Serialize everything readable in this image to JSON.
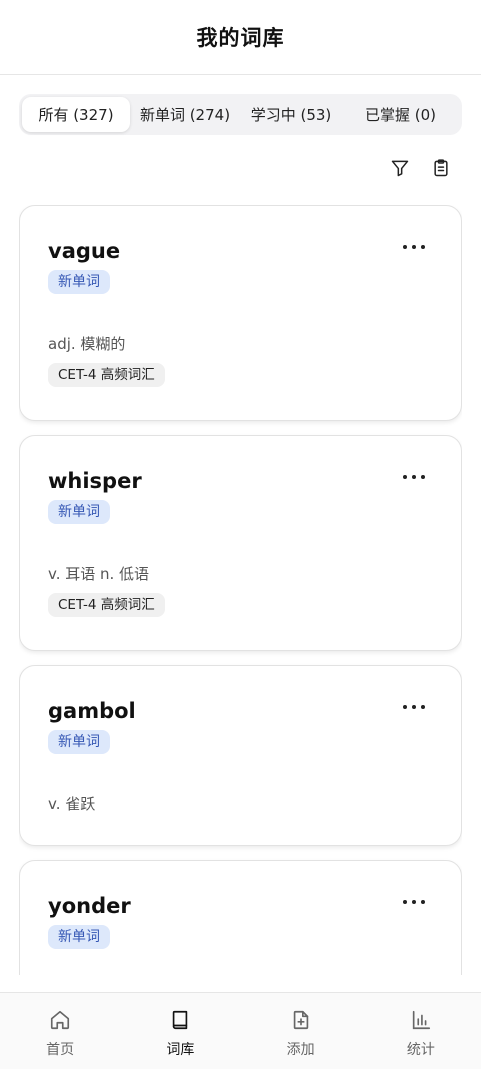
{
  "header": {
    "title": "我的词库"
  },
  "tabs": [
    {
      "label": "所有 (327)",
      "active": true
    },
    {
      "label": "新单词 (274)",
      "active": false
    },
    {
      "label": "学习中 (53)",
      "active": false
    },
    {
      "label": "已掌握 (0)",
      "active": false
    }
  ],
  "toolbar": {
    "filter_icon": "filter-icon",
    "clipboard_icon": "clipboard-icon"
  },
  "words": [
    {
      "word": "vague",
      "status": "新单词",
      "meaning": "adj. 模糊的",
      "tag": "CET-4 高频词汇"
    },
    {
      "word": "whisper",
      "status": "新单词",
      "meaning": "v. 耳语 n. 低语",
      "tag": "CET-4 高频词汇"
    },
    {
      "word": "gambol",
      "status": "新单词",
      "meaning": "v. 雀跃",
      "tag": ""
    },
    {
      "word": "yonder",
      "status": "新单词",
      "meaning": "",
      "tag": ""
    }
  ],
  "bottom_nav": [
    {
      "label": "首页",
      "icon": "home-icon",
      "active": false
    },
    {
      "label": "词库",
      "icon": "book-icon",
      "active": true
    },
    {
      "label": "添加",
      "icon": "add-file-icon",
      "active": false
    },
    {
      "label": "统计",
      "icon": "chart-icon",
      "active": false
    }
  ],
  "colors": {
    "status_bg": "#dde8fb",
    "status_text": "#3658b5",
    "tag_bg": "#f0f0f0"
  }
}
